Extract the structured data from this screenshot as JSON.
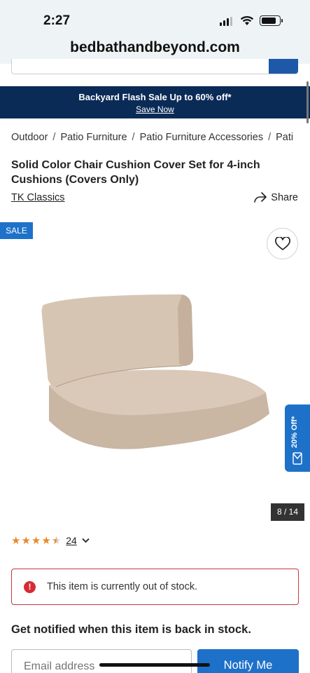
{
  "status_bar": {
    "time": "2:27"
  },
  "browser": {
    "url": "bedbathandbeyond.com"
  },
  "promo": {
    "title": "Backyard Flash Sale Up to 60% off*",
    "link": "Save Now"
  },
  "breadcrumbs": [
    "Outdoor",
    "Patio Furniture",
    "Patio Furniture Accessories",
    "Pati"
  ],
  "product": {
    "title": "Solid Color Chair Cushion Cover Set for 4-inch Cushions (Covers Only)",
    "brand": "TK Classics",
    "share_label": "Share",
    "sale_badge": "SALE",
    "image_counter": "8 / 14",
    "rating": 4.5,
    "review_count": "24",
    "out_of_stock_msg": "This item is currently out of stock.",
    "notify_heading": "Get notified when this item is back in stock.",
    "email_placeholder": "Email address",
    "notify_button": "Notify Me"
  },
  "offer_tab": {
    "label": "20% Off*"
  },
  "colors": {
    "navy": "#0b2b57",
    "blue": "#1e71c9",
    "error": "#c4363f",
    "star": "#e88a2a"
  }
}
